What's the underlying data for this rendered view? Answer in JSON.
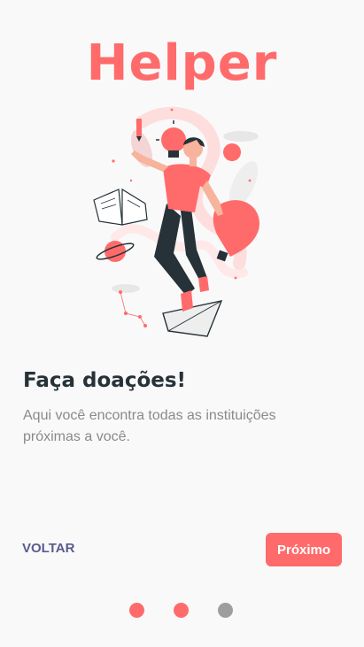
{
  "app": {
    "logo_text": "Helper"
  },
  "onboarding": {
    "title": "Faça doações!",
    "description": "Aqui você encontra todas as instituições próximas a você."
  },
  "navigation": {
    "back_label": "VOLTAR",
    "next_label": "Próximo"
  },
  "pagination": {
    "total": 3,
    "active_states": [
      true,
      true,
      false
    ]
  },
  "colors": {
    "accent": "#ff6b6b",
    "dark": "#263238",
    "muted_text": "#8a8a8a",
    "back_text": "#5a5b8f",
    "dot_inactive": "#9e9e9e"
  }
}
